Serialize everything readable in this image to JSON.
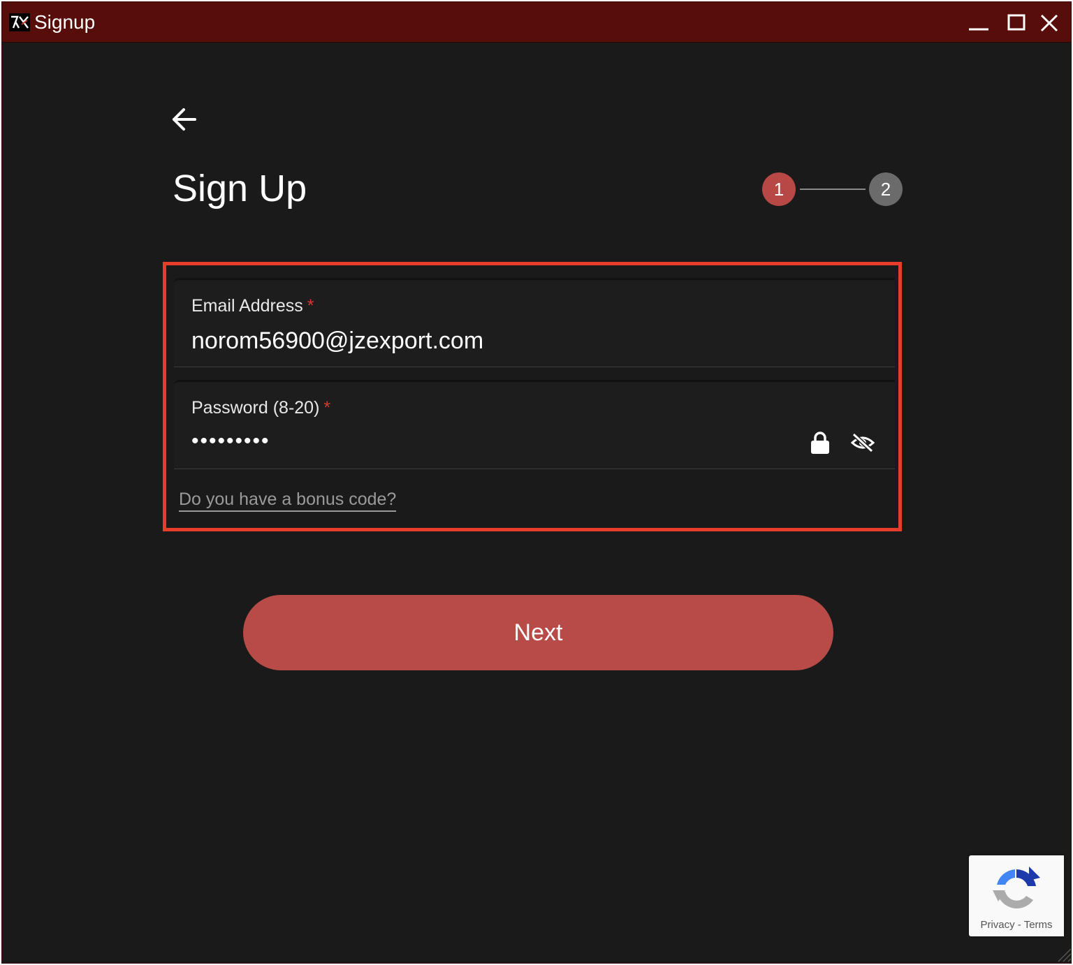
{
  "window": {
    "title": "Signup",
    "controls": [
      "minimize-icon",
      "maximize-icon",
      "close-icon"
    ]
  },
  "page": {
    "title": "Sign Up",
    "back_icon": "arrow-left-icon"
  },
  "stepper": {
    "steps": [
      "1",
      "2"
    ],
    "active_step": 1,
    "active_color": "#b84845",
    "inactive_color": "#6b6b6b"
  },
  "form": {
    "email": {
      "label": "Email Address",
      "required_mark": "*",
      "value": "norom56900@jzexport.com"
    },
    "password": {
      "label": "Password (8-20)",
      "required_mark": "*",
      "masked_value": "•••••••••",
      "lock_icon": "lock-icon",
      "visibility_icon": "eye-off-icon"
    },
    "bonus_link": "Do you have a bonus code?"
  },
  "next_button": {
    "label": "Next",
    "color": "#b84a47"
  },
  "recaptcha": {
    "privacy": "Privacy",
    "separator": " - ",
    "terms": "Terms"
  },
  "colors": {
    "titlebar": "#570d09",
    "background": "#1a1a1a",
    "highlight": "#e83d2a",
    "required": "#d63a2f"
  }
}
